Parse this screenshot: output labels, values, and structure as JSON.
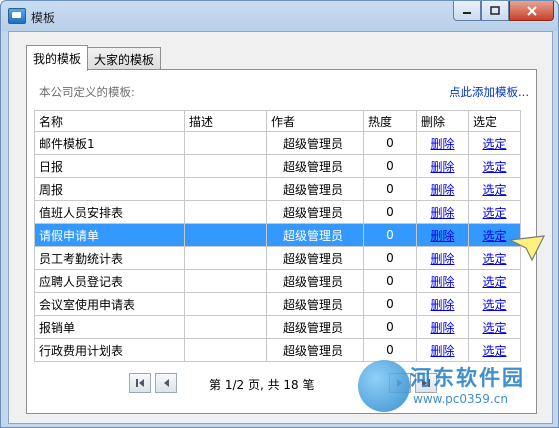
{
  "window": {
    "title": "模板"
  },
  "tabs": [
    {
      "label": "我的模板",
      "active": true
    },
    {
      "label": "大家的模板",
      "active": false
    }
  ],
  "panel": {
    "caption": "本公司定义的模板:",
    "add_link": "点此添加模板..."
  },
  "table": {
    "columns": [
      "名称",
      "描述",
      "作者",
      "热度",
      "删除",
      "选定"
    ],
    "rows": [
      {
        "name": "邮件模板1",
        "desc": "",
        "author": "超级管理员",
        "heat": "0",
        "delete": "删除",
        "select": "选定"
      },
      {
        "name": "日报",
        "desc": "",
        "author": "超级管理员",
        "heat": "0",
        "delete": "删除",
        "select": "选定"
      },
      {
        "name": "周报",
        "desc": "",
        "author": "超级管理员",
        "heat": "0",
        "delete": "删除",
        "select": "选定"
      },
      {
        "name": "值班人员安排表",
        "desc": "",
        "author": "超级管理员",
        "heat": "0",
        "delete": "删除",
        "select": "选定"
      },
      {
        "name": "请假申请单",
        "desc": "",
        "author": "超级管理员",
        "heat": "0",
        "delete": "删除",
        "select": "选定",
        "selected": true
      },
      {
        "name": "员工考勤统计表",
        "desc": "",
        "author": "超级管理员",
        "heat": "0",
        "delete": "删除",
        "select": "选定"
      },
      {
        "name": "应聘人员登记表",
        "desc": "",
        "author": "超级管理员",
        "heat": "0",
        "delete": "删除",
        "select": "选定"
      },
      {
        "name": "会议室使用申请表",
        "desc": "",
        "author": "超级管理员",
        "heat": "0",
        "delete": "删除",
        "select": "选定"
      },
      {
        "name": "报销单",
        "desc": "",
        "author": "超级管理员",
        "heat": "0",
        "delete": "删除",
        "select": "选定"
      },
      {
        "name": "行政费用计划表",
        "desc": "",
        "author": "超级管理员",
        "heat": "0",
        "delete": "删除",
        "select": "选定"
      }
    ]
  },
  "pager": {
    "text": "第 1/2 页, 共 18 笔"
  },
  "watermark": {
    "title": "河东软件园",
    "url": "www.pc0359.cn"
  },
  "colors": {
    "selection": "#3399ff",
    "link": "#0000ee",
    "titlebar": "#c9dcf1"
  }
}
